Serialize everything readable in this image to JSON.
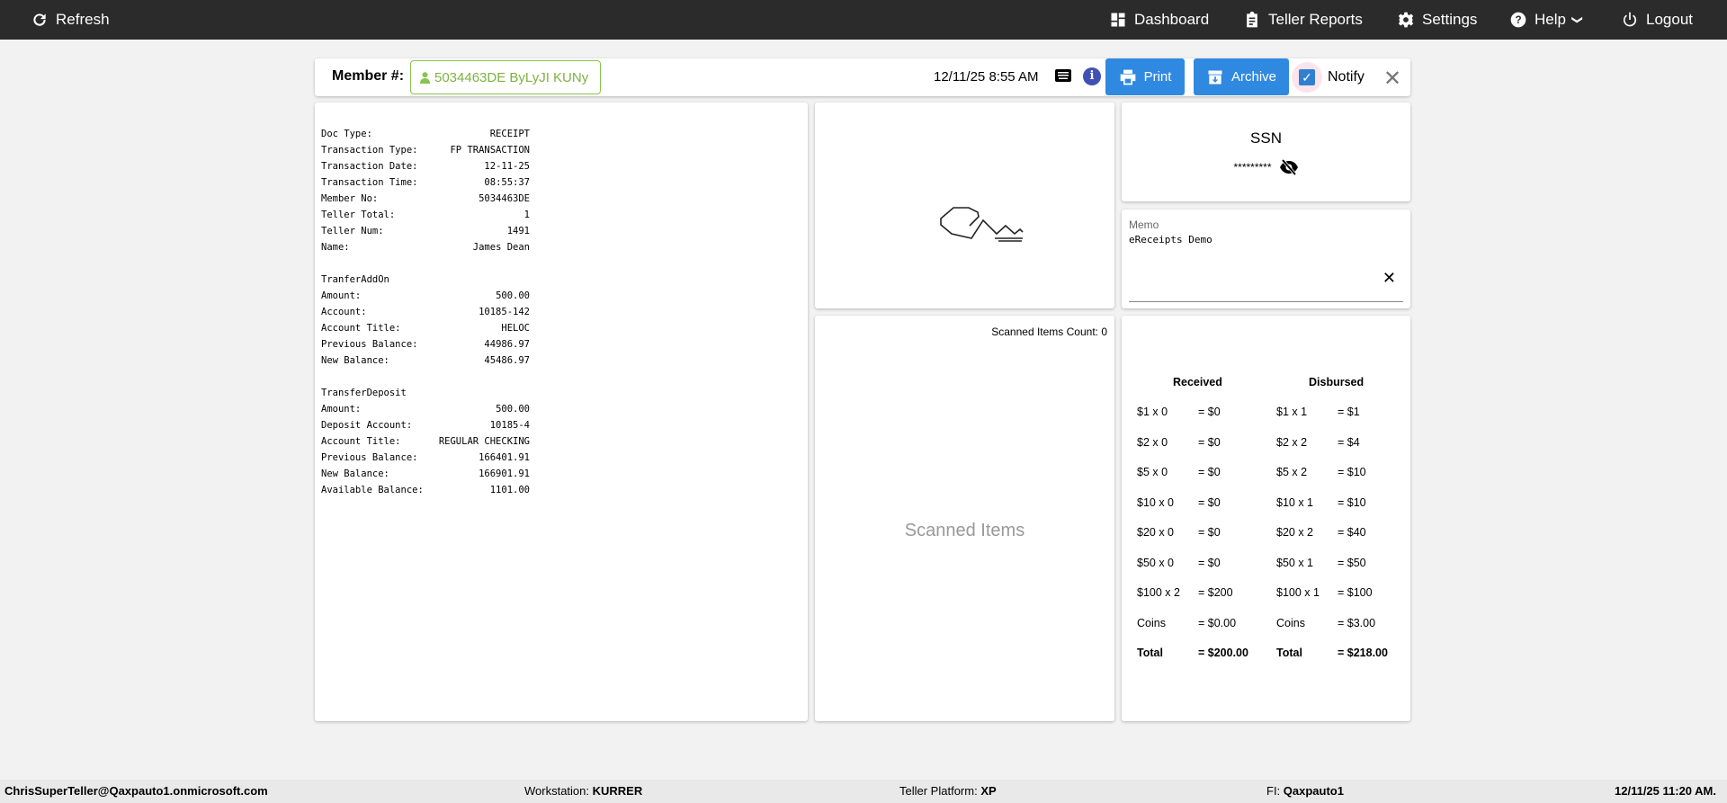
{
  "topbar": {
    "refresh": "Refresh",
    "dashboard": "Dashboard",
    "teller_reports": "Teller Reports",
    "settings": "Settings",
    "help": "Help",
    "logout": "Logout"
  },
  "header": {
    "member_label": "Member #:",
    "member_value": "5034463DE ByLyJI KUNy",
    "datetime": "12/11/25 8:55 AM",
    "print": "Print",
    "archive": "Archive",
    "notify": "Notify",
    "notify_checked": true,
    "accent": "#3089e0"
  },
  "receipt": [
    {
      "k": "Doc Type:",
      "v": "RECEIPT"
    },
    {
      "k": "Transaction Type:",
      "v": "FP TRANSACTION"
    },
    {
      "k": "Transaction Date:",
      "v": "12-11-25"
    },
    {
      "k": "Transaction Time:",
      "v": "08:55:37"
    },
    {
      "k": "Member No:",
      "v": "5034463DE"
    },
    {
      "k": "Teller Total:",
      "v": "1"
    },
    {
      "k": "Teller Num:",
      "v": "1491"
    },
    {
      "k": "Name:",
      "v": "James Dean"
    },
    {
      "k": "",
      "v": ""
    },
    {
      "k": "TranferAddOn",
      "v": ""
    },
    {
      "k": "Amount:",
      "v": "500.00"
    },
    {
      "k": "Account:",
      "v": "10185-142"
    },
    {
      "k": "Account Title:",
      "v": "HELOC"
    },
    {
      "k": "Previous Balance:",
      "v": "44986.97"
    },
    {
      "k": "New Balance:",
      "v": "45486.97"
    },
    {
      "k": "",
      "v": ""
    },
    {
      "k": "TransferDeposit",
      "v": ""
    },
    {
      "k": "Amount:",
      "v": "500.00"
    },
    {
      "k": "Deposit Account:",
      "v": "10185-4"
    },
    {
      "k": "Account Title:",
      "v": "REGULAR CHECKING"
    },
    {
      "k": "Previous Balance:",
      "v": "166401.91"
    },
    {
      "k": "New Balance:",
      "v": "166901.91"
    },
    {
      "k": "Available Balance:",
      "v": "1101.00"
    }
  ],
  "scanned": {
    "count_label": "Scanned Items Count: 0",
    "placeholder": "Scanned Items"
  },
  "ssn": {
    "title": "SSN",
    "value": "*********"
  },
  "memo": {
    "label": "Memo",
    "value": "eReceipts Demo"
  },
  "cash": {
    "received_title": "Received",
    "disbursed_title": "Disbursed",
    "received": [
      [
        "$1 x 0",
        "= $0"
      ],
      [
        "$2 x 0",
        "= $0"
      ],
      [
        "$5 x 0",
        "= $0"
      ],
      [
        "$10 x 0",
        "= $0"
      ],
      [
        "$20 x 0",
        "= $0"
      ],
      [
        "$50 x 0",
        "= $0"
      ],
      [
        "$100 x 2",
        "= $200"
      ],
      [
        "Coins",
        "= $0.00"
      ],
      [
        "Total",
        "= $200.00"
      ]
    ],
    "disbursed": [
      [
        "$1 x 1",
        "= $1"
      ],
      [
        "$2 x 2",
        "= $4"
      ],
      [
        "$5 x 2",
        "= $10"
      ],
      [
        "$10 x 1",
        "= $10"
      ],
      [
        "$20 x 2",
        "= $40"
      ],
      [
        "$50 x 1",
        "= $50"
      ],
      [
        "$100 x 1",
        "= $100"
      ],
      [
        "Coins",
        "= $3.00"
      ],
      [
        "Total",
        "= $218.00"
      ]
    ]
  },
  "footer": {
    "user": "ChrisSuperTeller@Qaxpauto1.onmicrosoft.com",
    "workstation_label": "Workstation: ",
    "workstation": "KURRER",
    "platform_label": "Teller Platform: ",
    "platform": "XP",
    "fi_label": "FI: ",
    "fi": "Qaxpauto1",
    "datetime": "12/11/25 11:20 AM."
  }
}
